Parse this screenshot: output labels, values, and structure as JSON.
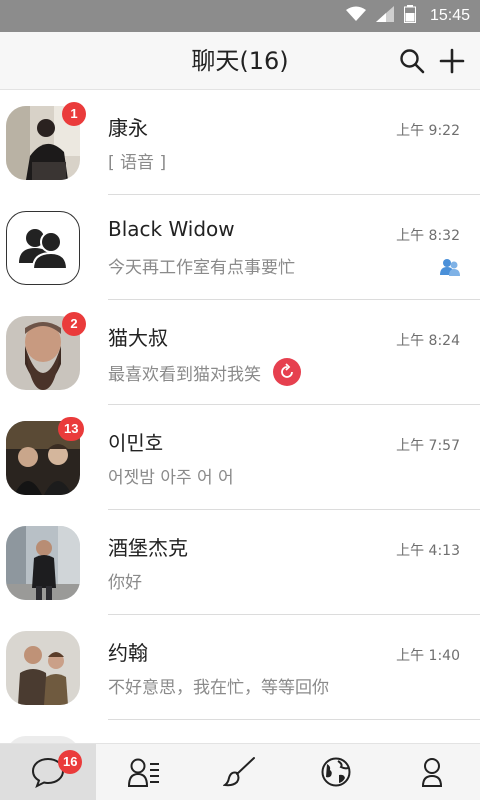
{
  "status_bar": {
    "time": "15:45"
  },
  "header": {
    "title": "聊天(16)"
  },
  "chats": [
    {
      "name": "康永",
      "message": "[ 语音 ]",
      "time": "上午 9:22",
      "badge": "1",
      "avatar": "photo-man-sitting"
    },
    {
      "name": "Black Widow",
      "message": "今天再工作室有点事要忙",
      "time": "上午 8:32",
      "badge": "",
      "avatar": "group-icon"
    },
    {
      "name": "猫大叔",
      "message": "最喜欢看到猫对我笑",
      "time": "上午 8:24",
      "badge": "2",
      "avatar": "photo-bearded-man"
    },
    {
      "name": "이민호",
      "message": "어젯밤 아주 어 어",
      "time": "上午 7:57",
      "badge": "13",
      "avatar": "photo-group-night"
    },
    {
      "name": "酒堡杰克",
      "message": "你好",
      "time": "上午 4:13",
      "badge": "",
      "avatar": "photo-man-street"
    },
    {
      "name": "约翰",
      "message": "不好意思，我在忙，等等回你",
      "time": "上午 1:40",
      "badge": "",
      "avatar": "photo-couple"
    }
  ],
  "tab_bar": {
    "tabs": [
      {
        "icon": "chat-bubble-icon",
        "badge": "16",
        "active": true
      },
      {
        "icon": "contacts-icon"
      },
      {
        "icon": "brush-icon"
      },
      {
        "icon": "globe-icon"
      },
      {
        "icon": "profile-icon"
      }
    ]
  },
  "colors": {
    "badge": "#ea3b3b",
    "retry": "#e6404f",
    "group_mark": "#4a90d9",
    "status_bar": "#8c8c8c"
  }
}
